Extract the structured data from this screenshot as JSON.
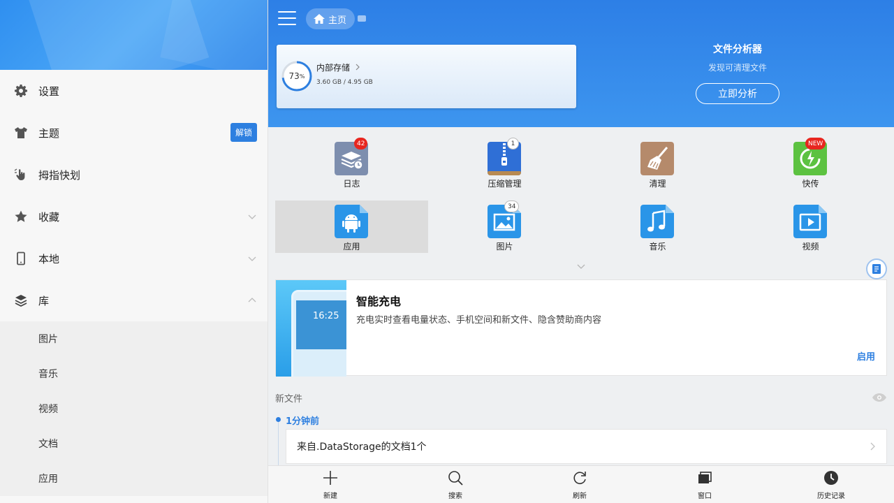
{
  "sidebar": {
    "items": [
      {
        "label": "设置",
        "icon": "gear-icon"
      },
      {
        "label": "主题",
        "icon": "shirt-icon",
        "badge": "解锁"
      },
      {
        "label": "拇指快划",
        "icon": "hand-swipe-icon"
      },
      {
        "label": "收藏",
        "icon": "star-icon"
      },
      {
        "label": "本地",
        "icon": "phone-icon"
      },
      {
        "label": "库",
        "icon": "layers-icon"
      }
    ],
    "library_subitems": [
      "图片",
      "音乐",
      "视频",
      "文档",
      "应用"
    ]
  },
  "header": {
    "breadcrumb": "主页"
  },
  "storage": {
    "name": "内部存储",
    "percent": 73,
    "percent_unit": "%",
    "size": "3.60 GB / 4.95 GB"
  },
  "analyzer": {
    "title": "文件分析器",
    "subtitle": "发现可清理文件",
    "button": "立即分析"
  },
  "grid": [
    {
      "label": "日志",
      "badge": "42",
      "icon": "log-icon"
    },
    {
      "label": "压缩管理",
      "badge": "1",
      "icon": "zip-icon"
    },
    {
      "label": "清理",
      "badge": "",
      "icon": "broom-icon"
    },
    {
      "label": "快传",
      "badge": "NEW",
      "icon": "transfer-icon"
    },
    {
      "label": "应用",
      "badge": "",
      "icon": "android-icon"
    },
    {
      "label": "图片",
      "badge": "34",
      "icon": "image-icon"
    },
    {
      "label": "音乐",
      "badge": "",
      "icon": "music-icon"
    },
    {
      "label": "视频",
      "badge": "",
      "icon": "video-icon"
    }
  ],
  "promo": {
    "title": "智能充电",
    "description": "充电实时查看电量状态、手机空间和新文件、隐含赞助商内容",
    "button": "启用",
    "phone_time": "16:25"
  },
  "new_files": {
    "title": "新文件",
    "time": "1分钟前",
    "entry": "来自.DataStorage的文档1个"
  },
  "bottom_bar": [
    {
      "label": "新建",
      "icon": "plus-icon"
    },
    {
      "label": "搜索",
      "icon": "search-icon"
    },
    {
      "label": "刷新",
      "icon": "refresh-icon"
    },
    {
      "label": "窗口",
      "icon": "windows-icon"
    },
    {
      "label": "历史记录",
      "icon": "history-icon"
    }
  ],
  "colors": {
    "accent": "#2d7fe0",
    "header": "#3a8fee",
    "badge_red": "#e8261f"
  }
}
